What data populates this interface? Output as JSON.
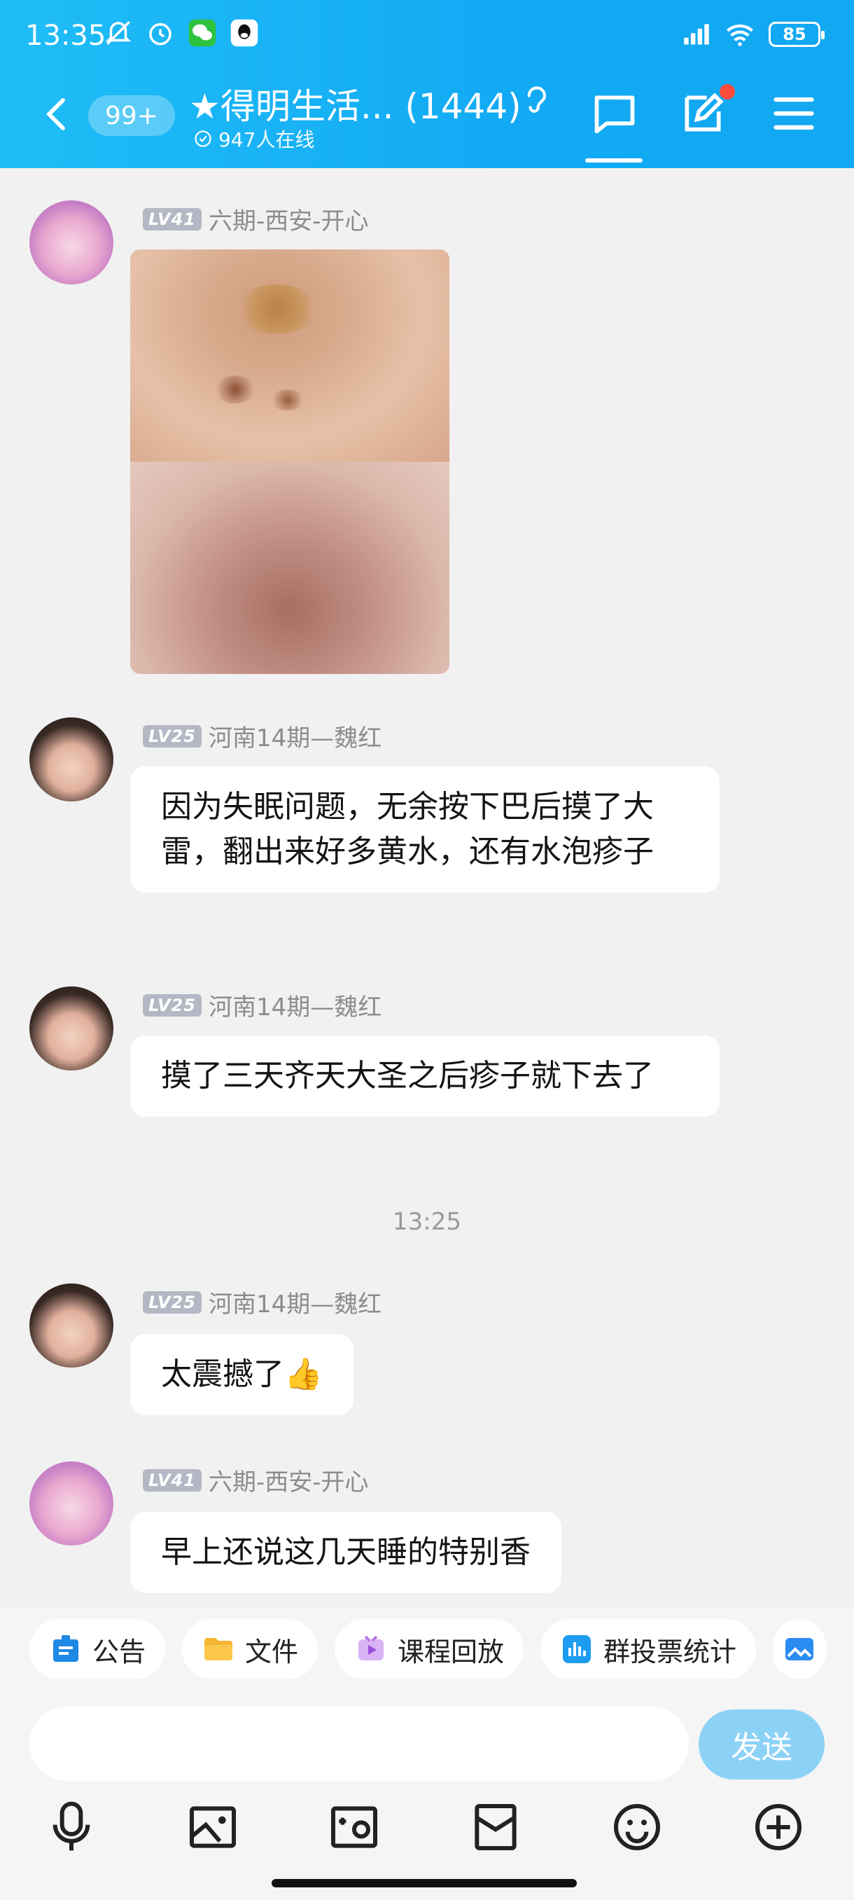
{
  "status_bar": {
    "time": "13:35",
    "battery": "85"
  },
  "header": {
    "back_label": "back",
    "unread_badge": "99+",
    "title": "★得明生活... (1444)",
    "online": "947人在线"
  },
  "messages": [
    {
      "sender": "六期-西安-开心",
      "level": "LV41",
      "type": "image"
    },
    {
      "sender": "河南14期—魏红",
      "level": "LV25",
      "text": "因为失眠问题，无余按下巴后摸了大雷，翻出来好多黄水，还有水泡疹子"
    },
    {
      "sender": "河南14期—魏红",
      "level": "LV25",
      "text": "摸了三天齐天大圣之后疹子就下去了"
    },
    {
      "sender": "河南14期—魏红",
      "level": "LV25",
      "text": "太震撼了👍"
    },
    {
      "sender": "六期-西安-开心",
      "level": "LV41",
      "text": "早上还说这几天睡的特别香"
    }
  ],
  "time_separator": "13:25",
  "quick_actions": [
    {
      "label": "公告",
      "icon": "announcement-icon"
    },
    {
      "label": "文件",
      "icon": "folder-icon"
    },
    {
      "label": "课程回放",
      "icon": "playback-icon"
    },
    {
      "label": "群投票统计",
      "icon": "chart-icon"
    }
  ],
  "input": {
    "placeholder": "",
    "send_label": "发送"
  },
  "toolbar": [
    "mic-icon",
    "image-icon",
    "camera-icon",
    "red-packet-icon",
    "emoji-icon",
    "plus-icon"
  ],
  "colors": {
    "header": "#12aaf4",
    "send": "#8cd2f6",
    "badge_dot": "#ff4b3a"
  }
}
